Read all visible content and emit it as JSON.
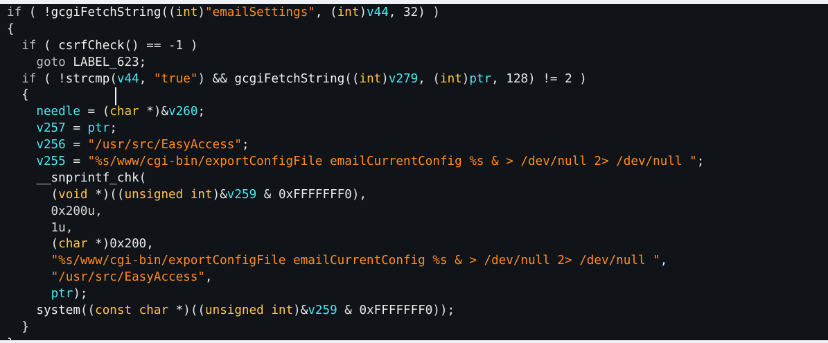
{
  "editor": {
    "theme": {
      "background": "#101418",
      "plain": "#e8e8e8",
      "keyword": "#bdbdbd",
      "type": "#ffc64a",
      "variable": "#4ce8f2",
      "string": "#ff8b22",
      "number": "#d5d5d5"
    },
    "lines": [
      [
        {
          "t": "if",
          "k": "kw"
        },
        {
          "t": " ( !",
          "k": "plain"
        },
        {
          "t": "gcgiFetchString",
          "k": "func"
        },
        {
          "t": "((",
          "k": "plain"
        },
        {
          "t": "int",
          "k": "type"
        },
        {
          "t": ")",
          "k": "plain"
        },
        {
          "t": "\"emailSettings\"",
          "k": "str"
        },
        {
          "t": ", (",
          "k": "plain"
        },
        {
          "t": "int",
          "k": "type"
        },
        {
          "t": ")",
          "k": "plain"
        },
        {
          "t": "v44",
          "k": "var"
        },
        {
          "t": ", 32) )",
          "k": "plain"
        }
      ],
      [
        {
          "t": "{",
          "k": "plain"
        }
      ],
      [
        {
          "t": "  ",
          "k": "plain"
        },
        {
          "t": "if",
          "k": "kw"
        },
        {
          "t": " ( ",
          "k": "plain"
        },
        {
          "t": "csrfCheck",
          "k": "func"
        },
        {
          "t": "() == -1 )",
          "k": "plain"
        }
      ],
      [
        {
          "t": "    ",
          "k": "plain"
        },
        {
          "t": "goto",
          "k": "kw"
        },
        {
          "t": " LABEL_623;",
          "k": "plain"
        }
      ],
      [
        {
          "t": "  ",
          "k": "plain"
        },
        {
          "t": "if",
          "k": "kw"
        },
        {
          "t": " ( !",
          "k": "plain"
        },
        {
          "t": "strcmp",
          "k": "func"
        },
        {
          "t": "(",
          "k": "plain"
        },
        {
          "t": "v44",
          "k": "var"
        },
        {
          "t": ", ",
          "k": "plain"
        },
        {
          "t": "\"true\"",
          "k": "str"
        },
        {
          "t": ") && ",
          "k": "plain"
        },
        {
          "t": "gcgiFetchString",
          "k": "func"
        },
        {
          "t": "((",
          "k": "plain"
        },
        {
          "t": "int",
          "k": "type"
        },
        {
          "t": ")",
          "k": "plain"
        },
        {
          "t": "v279",
          "k": "var"
        },
        {
          "t": ", (",
          "k": "plain"
        },
        {
          "t": "int",
          "k": "type"
        },
        {
          "t": ")",
          "k": "plain"
        },
        {
          "t": "ptr",
          "k": "var"
        },
        {
          "t": ", 128) != 2 )",
          "k": "plain"
        }
      ],
      [
        {
          "t": "  {",
          "k": "plain"
        }
      ],
      [
        {
          "t": "    ",
          "k": "plain"
        },
        {
          "t": "needle",
          "k": "var"
        },
        {
          "t": " = (",
          "k": "plain"
        },
        {
          "t": "char",
          "k": "type"
        },
        {
          "t": " *)&",
          "k": "plain"
        },
        {
          "t": "v260",
          "k": "var"
        },
        {
          "t": ";",
          "k": "plain"
        }
      ],
      [
        {
          "t": "    ",
          "k": "plain"
        },
        {
          "t": "v257",
          "k": "var"
        },
        {
          "t": " = ",
          "k": "plain"
        },
        {
          "t": "ptr",
          "k": "var"
        },
        {
          "t": ";",
          "k": "plain"
        }
      ],
      [
        {
          "t": "    ",
          "k": "plain"
        },
        {
          "t": "v256",
          "k": "var"
        },
        {
          "t": " = ",
          "k": "plain"
        },
        {
          "t": "\"/usr/src/EasyAccess\"",
          "k": "str"
        },
        {
          "t": ";",
          "k": "plain"
        }
      ],
      [
        {
          "t": "    ",
          "k": "plain"
        },
        {
          "t": "v255",
          "k": "var"
        },
        {
          "t": " = ",
          "k": "plain"
        },
        {
          "t": "\"%s/www/cgi-bin/exportConfigFile emailCurrentConfig %s & > /dev/null 2> /dev/null \"",
          "k": "str"
        },
        {
          "t": ";",
          "k": "plain"
        }
      ],
      [
        {
          "t": "    ",
          "k": "plain"
        },
        {
          "t": "__snprintf_chk",
          "k": "func"
        },
        {
          "t": "(",
          "k": "plain"
        }
      ],
      [
        {
          "t": "      (",
          "k": "plain"
        },
        {
          "t": "void",
          "k": "type"
        },
        {
          "t": " *)((",
          "k": "plain"
        },
        {
          "t": "unsigned int",
          "k": "type"
        },
        {
          "t": ")&",
          "k": "plain"
        },
        {
          "t": "v259",
          "k": "var"
        },
        {
          "t": " & 0xFFFFFFF0),",
          "k": "plain"
        }
      ],
      [
        {
          "t": "      0x200u,",
          "k": "num"
        }
      ],
      [
        {
          "t": "      1u,",
          "k": "num"
        }
      ],
      [
        {
          "t": "      (",
          "k": "plain"
        },
        {
          "t": "char",
          "k": "type"
        },
        {
          "t": " *)0x200,",
          "k": "plain"
        }
      ],
      [
        {
          "t": "      ",
          "k": "plain"
        },
        {
          "t": "\"%s/www/cgi-bin/exportConfigFile emailCurrentConfig %s & > /dev/null 2> /dev/null \"",
          "k": "str"
        },
        {
          "t": ",",
          "k": "plain"
        }
      ],
      [
        {
          "t": "      ",
          "k": "plain"
        },
        {
          "t": "\"/usr/src/EasyAccess\"",
          "k": "str"
        },
        {
          "t": ",",
          "k": "plain"
        }
      ],
      [
        {
          "t": "      ",
          "k": "plain"
        },
        {
          "t": "ptr",
          "k": "var"
        },
        {
          "t": ");",
          "k": "plain"
        }
      ],
      [
        {
          "t": "    ",
          "k": "plain"
        },
        {
          "t": "system",
          "k": "func"
        },
        {
          "t": "((",
          "k": "plain"
        },
        {
          "t": "const char",
          "k": "type"
        },
        {
          "t": " *)((",
          "k": "plain"
        },
        {
          "t": "unsigned int",
          "k": "type"
        },
        {
          "t": ")&",
          "k": "plain"
        },
        {
          "t": "v259",
          "k": "var"
        },
        {
          "t": " & 0xFFFFFFF0));",
          "k": "plain"
        }
      ],
      [
        {
          "t": "  }",
          "k": "plain"
        }
      ],
      [
        {
          "t": "}",
          "k": "plain"
        }
      ]
    ]
  }
}
